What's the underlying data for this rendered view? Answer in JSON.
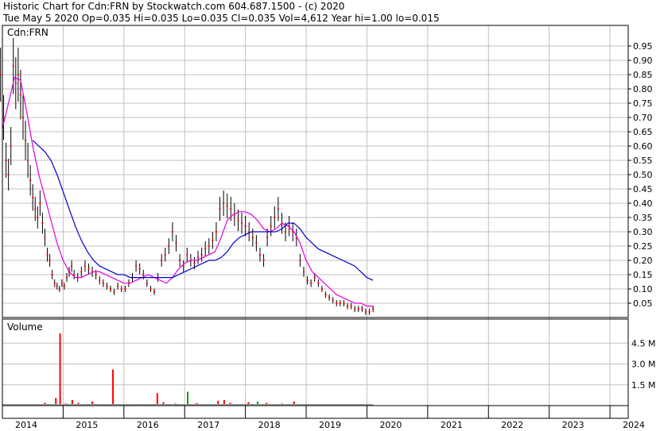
{
  "header": {
    "title": "Historic Chart for Cdn:FRN by Stockwatch.com 604.687.1500 - (c) 2020",
    "quote": "Tue May  5 2020   Op=0.035   Hi=0.035   Lo=0.035   Cl=0.035   Vol=4,612   Year hi=1.00   lo=0.015"
  },
  "chart_data": {
    "type": "line",
    "symbol_label": "Cdn:FRN",
    "volume_label": "Volume",
    "price_axis": {
      "ticks": [
        0.95,
        0.9,
        0.85,
        0.8,
        0.75,
        0.7,
        0.65,
        0.6,
        0.55,
        0.5,
        0.45,
        0.4,
        0.35,
        0.3,
        0.25,
        0.2,
        0.15,
        0.1,
        0.05
      ],
      "tick_labels": [
        "0.95",
        "0.90",
        "0.85",
        "0.80",
        "0.75",
        "0.70",
        "0.65",
        "0.60",
        "0.55",
        "0.50",
        "0.45",
        "0.40",
        "0.35",
        "0.30",
        "0.25",
        "0.20",
        "0.15",
        "0.10",
        "0.05"
      ],
      "range": [
        0.0,
        1.0
      ]
    },
    "volume_axis": {
      "ticks": [
        4.5,
        3.0,
        1.5
      ],
      "tick_labels": [
        "4.5 M",
        "3.0 M",
        "1.5 M"
      ],
      "range": [
        0,
        6.0
      ]
    },
    "x_axis": {
      "years": [
        "2014",
        "2015",
        "2016",
        "2017",
        "2018",
        "2019",
        "2020",
        "2021",
        "2022",
        "2023",
        "2024"
      ],
      "range": [
        2014.0,
        2024.3
      ]
    },
    "series": [
      {
        "role": "price",
        "color": "#000000",
        "x": [
          2013.97,
          2014.02,
          2014.06,
          2014.1,
          2014.14,
          2014.18,
          2014.22,
          2014.26,
          2014.3,
          2014.34,
          2014.38,
          2014.42,
          2014.46,
          2014.5,
          2014.54,
          2014.58,
          2014.62,
          2014.66,
          2014.7,
          2014.74,
          2014.78,
          2014.82,
          2014.86,
          2014.9,
          2014.94,
          2014.98,
          2015.02,
          2015.06,
          2015.1,
          2015.14,
          2015.18,
          2015.24,
          2015.3,
          2015.36,
          2015.42,
          2015.48,
          2015.54,
          2015.6,
          2015.66,
          2015.72,
          2015.78,
          2015.84,
          2015.9,
          2015.96,
          2016.02,
          2016.08,
          2016.14,
          2016.2,
          2016.26,
          2016.32,
          2016.38,
          2016.44,
          2016.5,
          2016.56,
          2016.62,
          2016.68,
          2016.74,
          2016.8,
          2016.86,
          2016.92,
          2016.98,
          2017.04,
          2017.1,
          2017.16,
          2017.22,
          2017.28,
          2017.34,
          2017.4,
          2017.46,
          2017.52,
          2017.58,
          2017.64,
          2017.7,
          2017.76,
          2017.82,
          2017.88,
          2017.94,
          2018.0,
          2018.06,
          2018.12,
          2018.18,
          2018.24,
          2018.3,
          2018.36,
          2018.42,
          2018.48,
          2018.54,
          2018.6,
          2018.66,
          2018.72,
          2018.78,
          2018.84,
          2018.9,
          2018.96,
          2019.02,
          2019.08,
          2019.14,
          2019.2,
          2019.26,
          2019.32,
          2019.38,
          2019.44,
          2019.5,
          2019.56,
          2019.62,
          2019.68,
          2019.74,
          2019.8,
          2019.86,
          2019.92,
          2019.98,
          2020.04,
          2020.1
        ],
        "y": [
          0.85,
          0.7,
          0.55,
          0.5,
          0.6,
          0.88,
          0.82,
          0.85,
          0.78,
          0.7,
          0.62,
          0.55,
          0.48,
          0.42,
          0.38,
          0.35,
          0.4,
          0.33,
          0.28,
          0.22,
          0.2,
          0.15,
          0.12,
          0.11,
          0.1,
          0.12,
          0.11,
          0.14,
          0.16,
          0.18,
          0.15,
          0.14,
          0.16,
          0.18,
          0.17,
          0.16,
          0.15,
          0.13,
          0.12,
          0.11,
          0.1,
          0.09,
          0.11,
          0.1,
          0.1,
          0.12,
          0.14,
          0.18,
          0.17,
          0.15,
          0.12,
          0.1,
          0.09,
          0.14,
          0.2,
          0.22,
          0.25,
          0.3,
          0.26,
          0.2,
          0.18,
          0.22,
          0.2,
          0.19,
          0.21,
          0.22,
          0.24,
          0.25,
          0.27,
          0.3,
          0.38,
          0.4,
          0.39,
          0.38,
          0.36,
          0.34,
          0.33,
          0.32,
          0.3,
          0.28,
          0.26,
          0.22,
          0.2,
          0.28,
          0.32,
          0.35,
          0.38,
          0.33,
          0.3,
          0.32,
          0.3,
          0.28,
          0.2,
          0.16,
          0.13,
          0.12,
          0.14,
          0.12,
          0.1,
          0.08,
          0.07,
          0.06,
          0.05,
          0.05,
          0.05,
          0.04,
          0.04,
          0.03,
          0.03,
          0.03,
          0.02,
          0.02,
          0.03
        ]
      },
      {
        "role": "moving-average-short",
        "color": "#e000e0",
        "x": [
          2014.0,
          2014.1,
          2014.2,
          2014.3,
          2014.4,
          2014.5,
          2014.6,
          2014.7,
          2014.8,
          2014.9,
          2015.0,
          2015.1,
          2015.2,
          2015.3,
          2015.4,
          2015.5,
          2015.6,
          2015.7,
          2015.8,
          2015.9,
          2016.0,
          2016.1,
          2016.2,
          2016.3,
          2016.4,
          2016.5,
          2016.6,
          2016.7,
          2016.8,
          2016.9,
          2017.0,
          2017.1,
          2017.2,
          2017.3,
          2017.4,
          2017.5,
          2017.6,
          2017.7,
          2017.8,
          2017.9,
          2018.0,
          2018.1,
          2018.2,
          2018.3,
          2018.4,
          2018.5,
          2018.6,
          2018.7,
          2018.8,
          2018.9,
          2019.0,
          2019.1,
          2019.2,
          2019.3,
          2019.4,
          2019.5,
          2019.6,
          2019.7,
          2019.8,
          2019.9,
          2020.0,
          2020.1
        ],
        "y": [
          0.66,
          0.75,
          0.84,
          0.83,
          0.72,
          0.6,
          0.5,
          0.42,
          0.34,
          0.26,
          0.2,
          0.16,
          0.14,
          0.14,
          0.15,
          0.16,
          0.16,
          0.15,
          0.14,
          0.13,
          0.12,
          0.12,
          0.13,
          0.14,
          0.15,
          0.14,
          0.13,
          0.12,
          0.14,
          0.17,
          0.19,
          0.2,
          0.2,
          0.21,
          0.22,
          0.23,
          0.28,
          0.34,
          0.36,
          0.37,
          0.37,
          0.36,
          0.34,
          0.31,
          0.3,
          0.31,
          0.33,
          0.32,
          0.3,
          0.26,
          0.2,
          0.16,
          0.14,
          0.12,
          0.1,
          0.08,
          0.07,
          0.06,
          0.05,
          0.05,
          0.04,
          0.04
        ]
      },
      {
        "role": "moving-average-long",
        "color": "#0000c8",
        "x": [
          2014.5,
          2014.6,
          2014.7,
          2014.8,
          2014.9,
          2015.0,
          2015.1,
          2015.2,
          2015.3,
          2015.4,
          2015.5,
          2015.6,
          2015.7,
          2015.8,
          2015.9,
          2016.0,
          2016.1,
          2016.2,
          2016.3,
          2016.4,
          2016.5,
          2016.6,
          2016.7,
          2016.8,
          2016.9,
          2017.0,
          2017.1,
          2017.2,
          2017.3,
          2017.4,
          2017.5,
          2017.6,
          2017.7,
          2017.8,
          2017.9,
          2018.0,
          2018.1,
          2018.2,
          2018.3,
          2018.4,
          2018.5,
          2018.6,
          2018.7,
          2018.8,
          2018.9,
          2019.0,
          2019.1,
          2019.2,
          2019.3,
          2019.4,
          2019.5,
          2019.6,
          2019.7,
          2019.8,
          2019.9,
          2020.0,
          2020.1
        ],
        "y": [
          0.62,
          0.6,
          0.58,
          0.55,
          0.5,
          0.44,
          0.38,
          0.32,
          0.27,
          0.23,
          0.2,
          0.18,
          0.17,
          0.16,
          0.15,
          0.15,
          0.14,
          0.14,
          0.14,
          0.14,
          0.14,
          0.14,
          0.14,
          0.14,
          0.15,
          0.16,
          0.17,
          0.18,
          0.19,
          0.2,
          0.2,
          0.21,
          0.23,
          0.26,
          0.28,
          0.29,
          0.3,
          0.3,
          0.3,
          0.3,
          0.3,
          0.31,
          0.33,
          0.33,
          0.31,
          0.28,
          0.26,
          0.24,
          0.23,
          0.22,
          0.21,
          0.2,
          0.19,
          0.18,
          0.16,
          0.14,
          0.13
        ]
      }
    ],
    "volume_bars": [
      {
        "x": 2014.5,
        "v": 0.1,
        "color": "#ff0000"
      },
      {
        "x": 2014.7,
        "v": 0.2,
        "color": "#ff0000"
      },
      {
        "x": 2014.88,
        "v": 0.55,
        "color": "#ff0000"
      },
      {
        "x": 2014.95,
        "v": 5.2,
        "color": "#ff0000"
      },
      {
        "x": 2015.05,
        "v": 0.15,
        "color": "#ff0000"
      },
      {
        "x": 2015.15,
        "v": 0.4,
        "color": "#ff0000"
      },
      {
        "x": 2015.25,
        "v": 0.2,
        "color": "#ff0000"
      },
      {
        "x": 2015.33,
        "v": 0.08,
        "color": "#ff0000"
      },
      {
        "x": 2015.48,
        "v": 0.3,
        "color": "#ff0000"
      },
      {
        "x": 2015.55,
        "v": 0.12,
        "color": "#ff0000"
      },
      {
        "x": 2015.7,
        "v": 0.1,
        "color": "#ff0000"
      },
      {
        "x": 2015.82,
        "v": 2.6,
        "color": "#ff0000"
      },
      {
        "x": 2016.0,
        "v": 0.1,
        "color": "#ff0000"
      },
      {
        "x": 2016.3,
        "v": 0.12,
        "color": "#ff0000"
      },
      {
        "x": 2016.55,
        "v": 0.9,
        "color": "#ff0000"
      },
      {
        "x": 2016.65,
        "v": 0.25,
        "color": "#ff0000"
      },
      {
        "x": 2016.85,
        "v": 0.15,
        "color": "#ff0000"
      },
      {
        "x": 2017.05,
        "v": 1.0,
        "color": "#00a000"
      },
      {
        "x": 2017.2,
        "v": 0.18,
        "color": "#ff0000"
      },
      {
        "x": 2017.55,
        "v": 0.35,
        "color": "#ff0000"
      },
      {
        "x": 2017.65,
        "v": 0.4,
        "color": "#ff0000"
      },
      {
        "x": 2017.75,
        "v": 0.2,
        "color": "#ff0000"
      },
      {
        "x": 2018.05,
        "v": 0.25,
        "color": "#ff0000"
      },
      {
        "x": 2018.2,
        "v": 0.3,
        "color": "#00a000"
      },
      {
        "x": 2018.35,
        "v": 0.2,
        "color": "#ff0000"
      },
      {
        "x": 2018.6,
        "v": 0.15,
        "color": "#ff0000"
      },
      {
        "x": 2018.8,
        "v": 0.3,
        "color": "#ff0000"
      },
      {
        "x": 2019.0,
        "v": 0.12,
        "color": "#ff0000"
      },
      {
        "x": 2019.2,
        "v": 0.1,
        "color": "#ff0000"
      },
      {
        "x": 2019.45,
        "v": 0.1,
        "color": "#ff0000"
      },
      {
        "x": 2019.7,
        "v": 0.08,
        "color": "#ff0000"
      },
      {
        "x": 2019.95,
        "v": 0.06,
        "color": "#ff0000"
      }
    ],
    "grid": true,
    "colors": {
      "background": "#ffffff",
      "grid": "#c0c0c0",
      "frame": "#000000",
      "volume_down": "#ff0000",
      "volume_up": "#00a000"
    }
  }
}
